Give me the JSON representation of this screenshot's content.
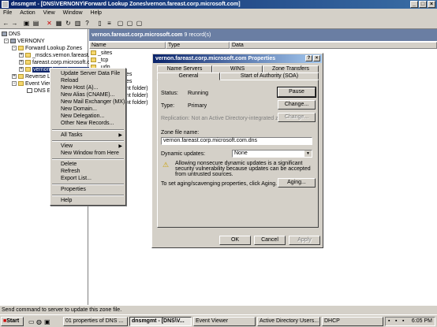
{
  "window": {
    "title": "dnsmgmt - [DNS\\VERNONY\\Forward Lookup Zones\\vernon.fareast.corp.microsoft.com]"
  },
  "menubar": [
    "File",
    "Action",
    "View",
    "Window",
    "Help"
  ],
  "tree": {
    "root": "DNS",
    "server": "VERNONY",
    "forward": "Forward Lookup Zones",
    "zone1": "_msdcs.vernon.fareast.c",
    "zone2": "fareast.corp.microsoft.cc",
    "zone3": "vernon.fareast.corp.micr",
    "reverse": "Reverse Lookup Zones",
    "event_viewer": "Event Viewer",
    "dns_events": "DNS Events"
  },
  "pane": {
    "header": "vernon.fareast.corp.microsoft.com",
    "count": "9 record(s)",
    "columns": [
      "Name",
      "Type",
      "Data"
    ],
    "rows": [
      "_sites",
      "_tcp",
      "_udp",
      "es",
      "es",
      "nt folder)",
      "nt folder)",
      "nt folder)"
    ]
  },
  "context_menu": {
    "items": [
      "Update Server Data File",
      "Reload",
      "New Host (A)...",
      "New Alias (CNAME)...",
      "New Mail Exchanger (MX)...",
      "New Domain...",
      "New Delegation...",
      "Other New Records..."
    ],
    "all_tasks": "All Tasks",
    "view": "View",
    "new_window": "New Window from Here",
    "delete": "Delete",
    "refresh": "Refresh",
    "export": "Export List...",
    "properties": "Properties",
    "help": "Help"
  },
  "dialog": {
    "title": "vernon.fareast.corp.microsoft.com Properties",
    "tabs_row1": [
      "Name Servers",
      "WINS",
      "Zone Transfers"
    ],
    "tabs_row2": [
      "General",
      "Start of Authority (SOA)"
    ],
    "status_label": "Status:",
    "status_value": "Running",
    "pause": "Pause",
    "type_label": "Type:",
    "type_value": "Primary",
    "change": "Change...",
    "replication": "Replication:  Not an Active Directory-integrated zone",
    "change2": "Change...",
    "zone_file_label": "Zone file name:",
    "zone_file_value": "vernon.fareast.corp.microsoft.com.dns",
    "dynamic_label": "Dynamic updates:",
    "dynamic_value": "None",
    "warning": "Allowing nonsecure dynamic updates is a significant security vulnerability because updates can be accepted from untrusted sources.",
    "aging_text": "To set aging/scavenging properties, click Aging.",
    "aging": "Aging...",
    "ok": "OK",
    "cancel": "Cancel",
    "apply": "Apply"
  },
  "statusbar": "Send command to server to update this zone file.",
  "taskbar": {
    "start": "Start",
    "tasks": [
      "01 properties of DNS ...",
      "dnsmgmt - [DNS\\V...",
      "Event Viewer",
      "Active Directory Users...",
      "DHCP"
    ],
    "clock": "6:05 PM"
  }
}
